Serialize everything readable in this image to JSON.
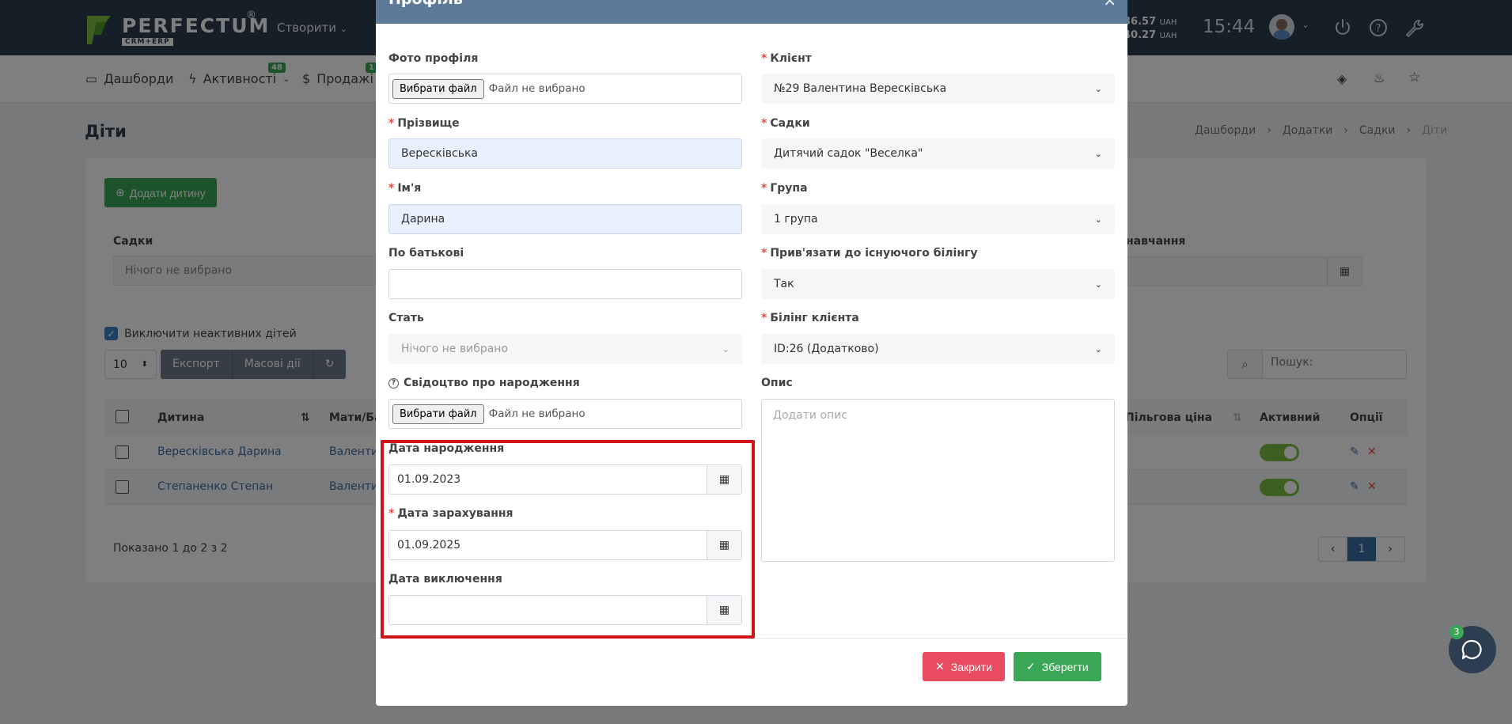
{
  "header": {
    "logo_text": "PERFECTUM",
    "logo_sub": "CRM+ERP",
    "logo_reg": "®",
    "create_menu": "Створити",
    "rate_1": "36.57",
    "rate_2": "40.27",
    "currency": "UAH",
    "clock": "15:44"
  },
  "nav": {
    "dashboards": "Дашборди",
    "activities": "Активності",
    "activities_badge": "48",
    "sales": "Продажі",
    "sales_badge": "1"
  },
  "page": {
    "title": "Діти",
    "breadcrumb": [
      "Дашборди",
      "Додатки",
      "Садки",
      "Діти"
    ],
    "add_button": "Додати дитину",
    "filter_kindergarten_label": "Садки",
    "filter_kindergarten_value": "Нічого не вибрано",
    "filter_study_label": "навчання",
    "exclude_inactive_label": "Виключити неактивних дітей",
    "page_size": "10",
    "export_button": "Експорт",
    "bulk_actions_button": "Масові дії",
    "search_placeholder": "Пошук:",
    "columns": {
      "child": "Дитина",
      "parent": "Мати/Бат",
      "discount_price": "Пільгова ціна",
      "active": "Активний",
      "options": "Опції"
    },
    "rows": [
      {
        "child": "Верескiвська Дарина",
        "parent": "Валентин"
      },
      {
        "child": "Степаненко Степан",
        "parent": "Валентин"
      }
    ],
    "shown_text": "Показано 1 до 2 з 2",
    "page_current": "1",
    "page_prev": "‹",
    "page_next": "›"
  },
  "modal": {
    "title": "Профіль",
    "close_icon": "×",
    "photo_label": "Фото профіля",
    "file_button": "Вибрати файл",
    "file_none": "Файл не вибрано",
    "client_label": "Клієнт",
    "client_value": "№29 Валентина Верескiвська",
    "surname_label": "Прізвище",
    "surname_value": "Верескiвська",
    "kindergarten_label": "Садки",
    "kindergarten_value": "Дитячий садок \"Веселка\"",
    "name_label": "Ім'я",
    "name_value": "Дарина",
    "group_label": "Група",
    "group_value": "1 група",
    "patronymic_label": "По батькові",
    "patronymic_value": "",
    "billing_link_label": "Прив'язати до існуючого білінгу",
    "billing_link_value": "Так",
    "gender_label": "Стать",
    "gender_value": "Нічого не вибрано",
    "client_billing_label": "Білінг клієнта",
    "client_billing_value": "ID:26 (Додатково)",
    "certificate_label": "Свідоцтво про народження",
    "description_label": "Опис",
    "description_placeholder": "Додати опис",
    "birth_date_label": "Дата народження",
    "birth_date_value": "01.09.2023",
    "enroll_date_label": "Дата зарахування",
    "enroll_date_value": "01.09.2025",
    "exclude_date_label": "Дата виключення",
    "exclude_date_value": "",
    "close_button": "Закрити",
    "save_button": "Зберегти"
  },
  "chat": {
    "badge": "3"
  },
  "colors": {
    "accent_green": "#3aa757",
    "danger": "#e94b60",
    "header": "#2d3e50",
    "highlight": "#d0121b"
  }
}
